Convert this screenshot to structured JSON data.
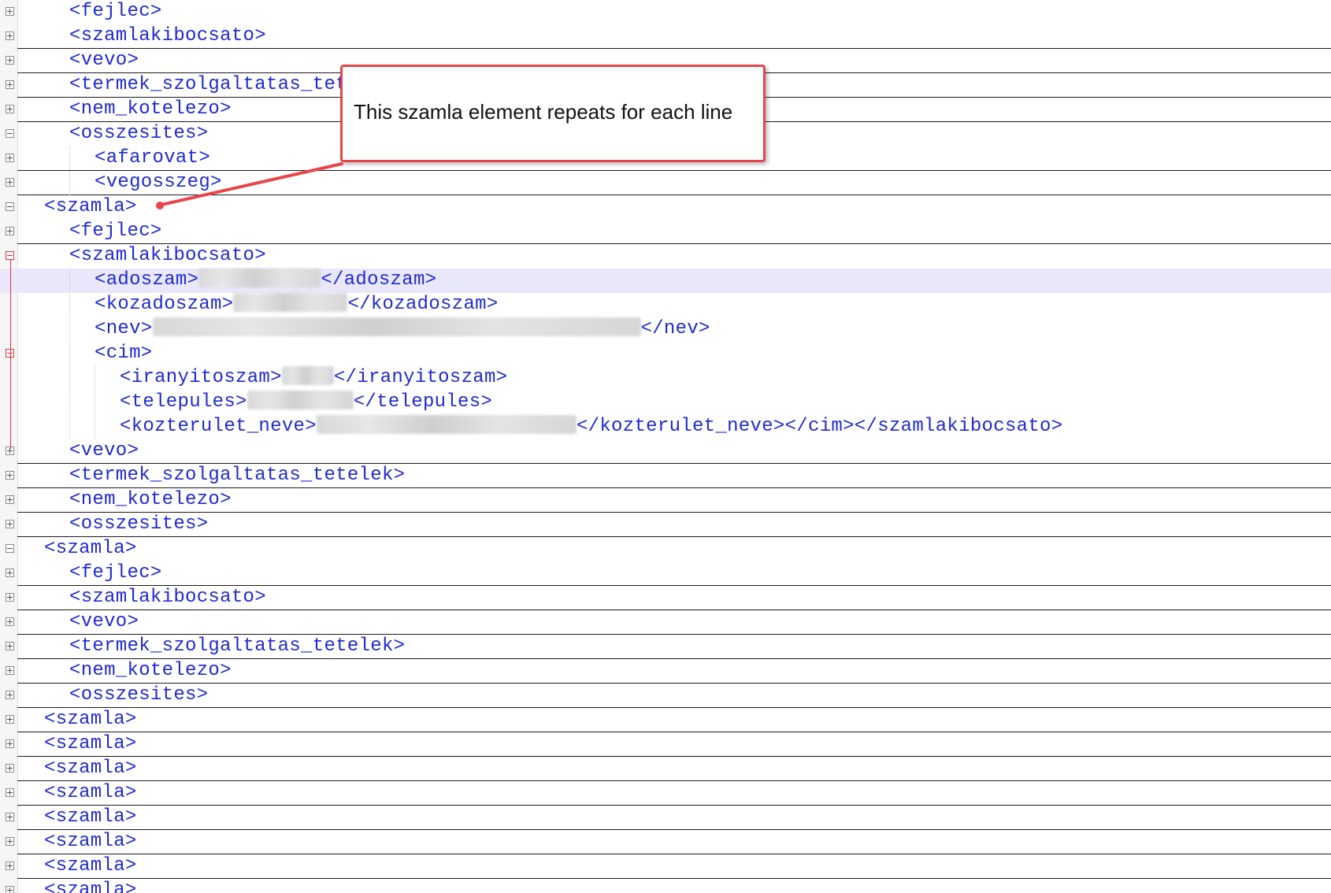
{
  "colors": {
    "tag": "#1f2ad4",
    "callout_border": "#e8454b",
    "highlight_line": "#e8e8fa",
    "fold_red": "#e0303a"
  },
  "icons": {
    "fold_collapsed": "plus-box-icon",
    "fold_expanded": "minus-box-icon"
  },
  "callout": {
    "text": "This szamla element repeats for each line"
  },
  "lines": [
    {
      "fold": "plus",
      "indent": 2,
      "text": "<fejlec>",
      "ul": false
    },
    {
      "fold": "plus",
      "indent": 2,
      "text": "<szamlakibocsato>",
      "ul": true
    },
    {
      "fold": "plus",
      "indent": 2,
      "text": "<vevo>",
      "ul": true
    },
    {
      "fold": "plus",
      "indent": 2,
      "text": "<termek_szolgaltatas_tetelek>",
      "ul": true
    },
    {
      "fold": "plus",
      "indent": 2,
      "text": "<nem_kotelezo>",
      "ul": true
    },
    {
      "fold": "minus",
      "indent": 2,
      "text": "<osszesites>",
      "ul": false
    },
    {
      "fold": "plus",
      "indent": 3,
      "text": "<afarovat>",
      "ul": true
    },
    {
      "fold": "plus",
      "indent": 3,
      "text": "<vegosszeg>",
      "ul": true
    },
    {
      "fold": "minus",
      "indent": 1,
      "text": "<szamla>",
      "ul": false
    },
    {
      "fold": "plus",
      "indent": 2,
      "text": "<fejlec>",
      "ul": true
    },
    {
      "fold": "minus-red",
      "indent": 2,
      "text": "<szamlakibocsato>",
      "ul": false
    },
    {
      "fold": "none",
      "indent": 3,
      "text": "<adoszam>",
      "blur": 155,
      "tail": "</adoszam>",
      "ul": false,
      "hl": true
    },
    {
      "fold": "none",
      "indent": 3,
      "text": "<kozadoszam>",
      "blur": 145,
      "tail": "</kozadoszam>",
      "ul": false
    },
    {
      "fold": "none",
      "indent": 3,
      "text": "<nev>",
      "blur": 620,
      "tail": "</nev>",
      "ul": false
    },
    {
      "fold": "minus-red",
      "indent": 3,
      "text": "<cim>",
      "ul": false
    },
    {
      "fold": "none",
      "indent": 4,
      "text": "<iranyitoszam>",
      "blur": 66,
      "tail": "</iranyitoszam>",
      "ul": false
    },
    {
      "fold": "none",
      "indent": 4,
      "text": "<telepules>",
      "blur": 135,
      "tail": "</telepules>",
      "ul": false
    },
    {
      "fold": "none",
      "indent": 4,
      "text": "<kozterulet_neve>",
      "blur": 330,
      "tail": "</kozterulet_neve></cim></szamlakibocsato>",
      "ul": false
    },
    {
      "fold": "plus",
      "indent": 2,
      "text": "<vevo>",
      "ul": true
    },
    {
      "fold": "plus",
      "indent": 2,
      "text": "<termek_szolgaltatas_tetelek>",
      "ul": true
    },
    {
      "fold": "plus",
      "indent": 2,
      "text": "<nem_kotelezo>",
      "ul": true
    },
    {
      "fold": "plus",
      "indent": 2,
      "text": "<osszesites>",
      "ul": true
    },
    {
      "fold": "minus",
      "indent": 1,
      "text": "<szamla>",
      "ul": false
    },
    {
      "fold": "plus",
      "indent": 2,
      "text": "<fejlec>",
      "ul": true
    },
    {
      "fold": "plus",
      "indent": 2,
      "text": "<szamlakibocsato>",
      "ul": true
    },
    {
      "fold": "plus",
      "indent": 2,
      "text": "<vevo>",
      "ul": true
    },
    {
      "fold": "plus",
      "indent": 2,
      "text": "<termek_szolgaltatas_tetelek>",
      "ul": true
    },
    {
      "fold": "plus",
      "indent": 2,
      "text": "<nem_kotelezo>",
      "ul": true
    },
    {
      "fold": "plus",
      "indent": 2,
      "text": "<osszesites>",
      "ul": true
    },
    {
      "fold": "plus",
      "indent": 1,
      "text": "<szamla>",
      "ul": true
    },
    {
      "fold": "plus",
      "indent": 1,
      "text": "<szamla>",
      "ul": true
    },
    {
      "fold": "plus",
      "indent": 1,
      "text": "<szamla>",
      "ul": true
    },
    {
      "fold": "plus",
      "indent": 1,
      "text": "<szamla>",
      "ul": true
    },
    {
      "fold": "plus",
      "indent": 1,
      "text": "<szamla>",
      "ul": true
    },
    {
      "fold": "plus",
      "indent": 1,
      "text": "<szamla>",
      "ul": true
    },
    {
      "fold": "plus",
      "indent": 1,
      "text": "<szamla>",
      "ul": true
    },
    {
      "fold": "plus",
      "indent": 1,
      "text": "<szamla>",
      "ul": true
    }
  ]
}
